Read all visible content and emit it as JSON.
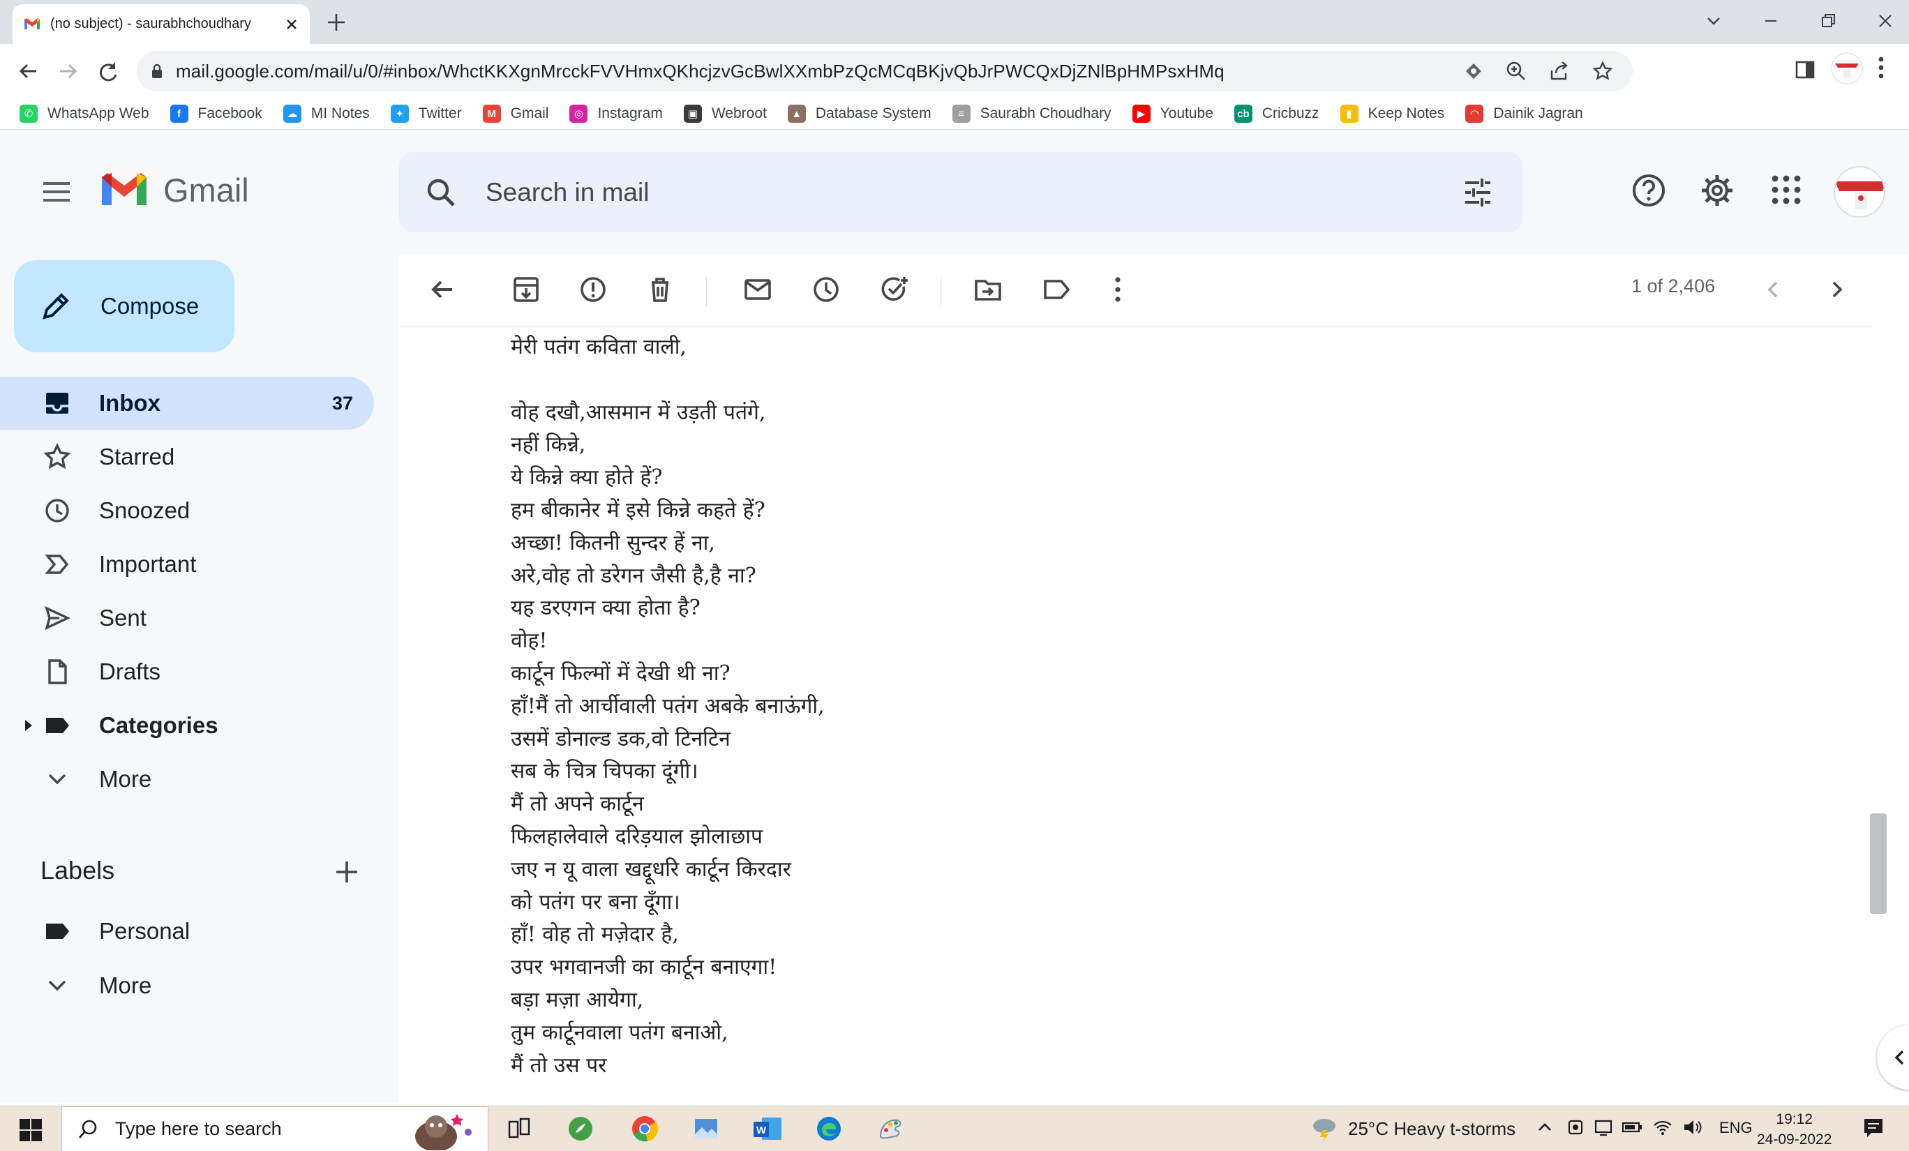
{
  "browser": {
    "tab_title": "(no subject) - saurabhchoudhary",
    "url": "mail.google.com/mail/u/0/#inbox/WhctKKXgnMrcckFVVHmxQKhcjzvGcBwlXXmbPzQcMCqBKjvQbJrPWCQxDjZNlBpHMPsxHMq",
    "bookmarks": [
      {
        "label": "WhatsApp Web",
        "icon": "whatsapp-icon",
        "color": "#25d366"
      },
      {
        "label": "Facebook",
        "icon": "facebook-icon",
        "color": "#1877f2"
      },
      {
        "label": "MI Notes",
        "icon": "notes-icon",
        "color": "#2196f3"
      },
      {
        "label": "Twitter",
        "icon": "twitter-icon",
        "color": "#1da1f2"
      },
      {
        "label": "Gmail",
        "icon": "gmail-icon",
        "color": "#ea4335"
      },
      {
        "label": "Instagram",
        "icon": "instagram-icon",
        "color": "#d6249f"
      },
      {
        "label": "Webroot",
        "icon": "webroot-icon",
        "color": "#3a3a3a"
      },
      {
        "label": "Database System",
        "icon": "database-icon",
        "color": "#8d6e63"
      },
      {
        "label": "Saurabh Choudhary",
        "icon": "document-icon",
        "color": "#9e9e9e"
      },
      {
        "label": "Youtube",
        "icon": "youtube-icon",
        "color": "#ff0000"
      },
      {
        "label": "Cricbuzz",
        "icon": "cricbuzz-icon",
        "color": "#009270"
      },
      {
        "label": "Keep Notes",
        "icon": "keep-icon",
        "color": "#fbbc04"
      },
      {
        "label": "Dainik Jagran",
        "icon": "jagran-icon",
        "color": "#e53935"
      }
    ]
  },
  "gmail": {
    "brand": "Gmail",
    "search_placeholder": "Search in mail",
    "compose_label": "Compose",
    "nav": [
      {
        "label": "Inbox",
        "icon": "inbox-icon",
        "count": "37",
        "active": true
      },
      {
        "label": "Starred",
        "icon": "star-icon"
      },
      {
        "label": "Snoozed",
        "icon": "clock-icon"
      },
      {
        "label": "Important",
        "icon": "important-icon"
      },
      {
        "label": "Sent",
        "icon": "send-icon"
      },
      {
        "label": "Drafts",
        "icon": "draft-icon"
      },
      {
        "label": "Categories",
        "icon": "label-icon"
      },
      {
        "label": "More",
        "icon": "chevron-down-icon"
      }
    ],
    "labels_heading": "Labels",
    "labels": [
      {
        "label": "Personal",
        "icon": "label-icon"
      },
      {
        "label": "More",
        "icon": "chevron-down-icon"
      }
    ],
    "pager": "1 of 2,406",
    "email_body": [
      "मेरी पतंग कविता वाली,",
      "",
      "वोह दखौ,आसमान में उड़ती पतंगे,",
      "नहीं किन्ने,",
      "ये किन्ने क्या होते हें?",
      "हम बीकानेर में इसे किन्ने कहते हें?",
      "अच्छा! कितनी सुन्दर हें ना,",
      "अरे,वोह तो डरेगन जैसी है,है ना?",
      "यह डरएगन क्या होता है?",
      "वोह!",
      "कार्टून फिल्मों में देखी थी ना?",
      "हाँ!मैं तो आर्चीवाली पतंग अबके बनाऊंगी,",
      "उसमें डोनाल्ड डक,वो टिनटिन",
      "सब के चित्र चिपका दूंगी।",
      "मैं तो अपने कार्टून",
      " फिलहालेवाले दरिड़याल झोलाछाप",
      "जए न यू वाला खद्दूधरि कार्टून किरदार",
      "को पतंग पर बना दूँगा।",
      "हाँ! वोह तो मज़ेदार है,",
      "उपर भगवानजी का कार्टून बनाएगा!",
      "बड़ा मज़ा आयेगा,",
      "तुम कार्टूनवाला पतंग बनाओ,",
      "मैं तो उस पर"
    ]
  },
  "taskbar": {
    "search_placeholder": "Type here to search",
    "weather": "25°C  Heavy t-storms",
    "language": "ENG",
    "time": "19:12",
    "date": "24-09-2022"
  }
}
